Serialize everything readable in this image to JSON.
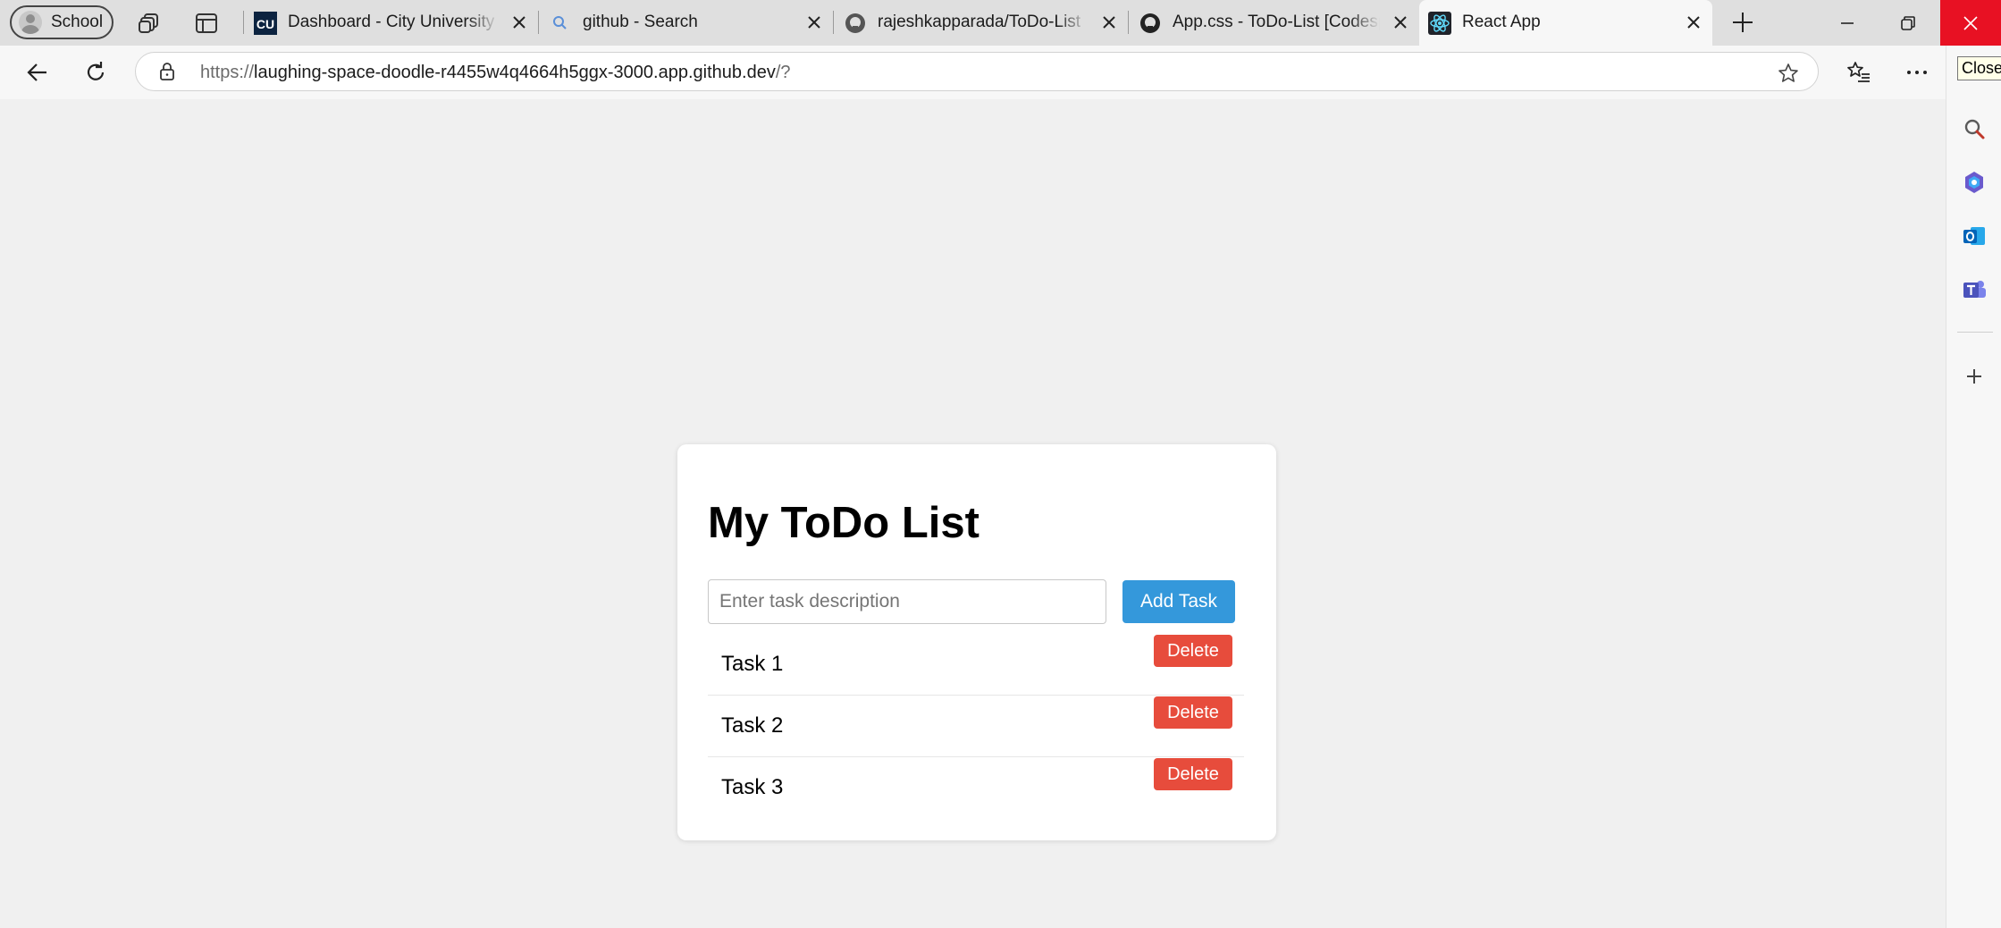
{
  "profile": {
    "label": "School"
  },
  "tabs": [
    {
      "title": "Dashboard - City University of Seattle",
      "favicon": "cityu-icon"
    },
    {
      "title": "github - Search",
      "favicon": "search-icon"
    },
    {
      "title": "rajeshkapparada/ToDo-List",
      "favicon": "github-icon"
    },
    {
      "title": "App.css - ToDo-List [Codespaces]",
      "favicon": "github-icon"
    },
    {
      "title": "React App",
      "favicon": "react-icon",
      "active": true
    }
  ],
  "address_bar": {
    "scheme": "https://",
    "host": "laughing-space-doodle-r4455w4q4664h5ggx-3000.app.github.dev",
    "path": "/?"
  },
  "tooltip": {
    "text": "Close"
  },
  "app": {
    "title": "My ToDo List",
    "input_placeholder": "Enter task description",
    "input_value": "",
    "add_button": "Add Task",
    "tasks": [
      {
        "text": "Task 1",
        "delete_label": "Delete"
      },
      {
        "text": "Task 2",
        "delete_label": "Delete"
      },
      {
        "text": "Task 3",
        "delete_label": "Delete"
      }
    ]
  },
  "colors": {
    "add_button": "#3498db",
    "delete_button": "#e74c3c",
    "page_background": "#f0f0f0",
    "window_close": "#e81123"
  }
}
